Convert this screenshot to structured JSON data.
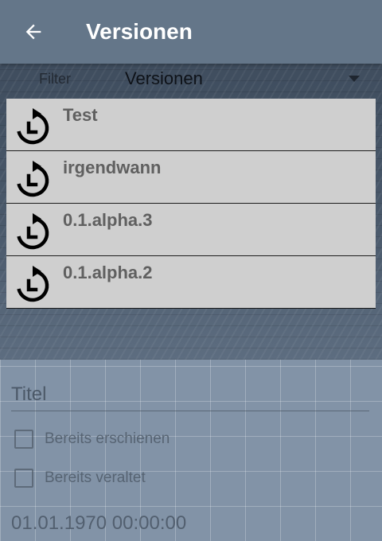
{
  "appbar": {
    "title": "Versionen",
    "back_icon": "arrow-left-icon",
    "background": "#647689"
  },
  "filter": {
    "label": "Filter",
    "selected": "Versionen"
  },
  "versions": [
    {
      "label": "Test",
      "icon": "history-icon"
    },
    {
      "label": "irgendwann",
      "icon": "history-icon"
    },
    {
      "label": "0.1.alpha.3",
      "icon": "history-icon"
    },
    {
      "label": "0.1.alpha.2",
      "icon": "history-icon"
    }
  ],
  "form": {
    "title_placeholder": "Titel",
    "checkbox_published": "Bereits erschienen",
    "checkbox_deprecated": "Bereits veraltet",
    "date": "01.01.1970 00:00:00"
  }
}
